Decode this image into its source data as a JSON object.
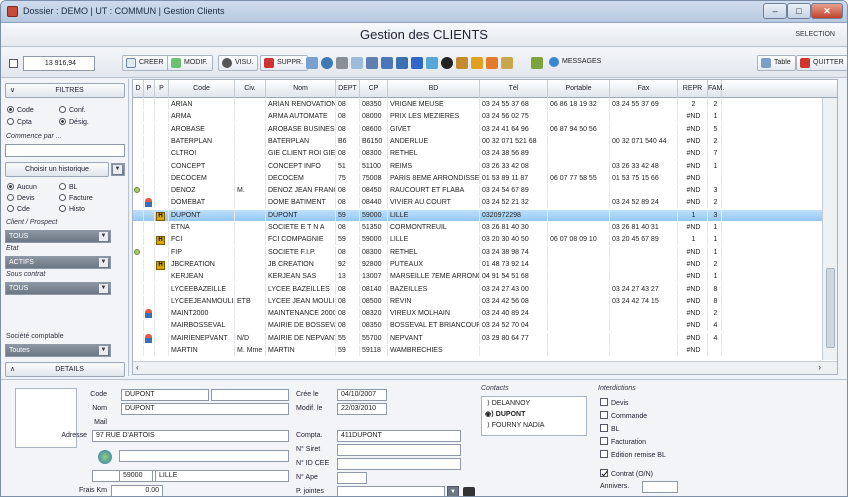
{
  "window": {
    "title": "Dossier : DEMO | UT : COMMUN | Gestion Clients"
  },
  "header": {
    "title": "Gestion des CLIENTS",
    "selection": "SELECTION"
  },
  "toolbar": {
    "count": "13 916,94",
    "creer": "CREER",
    "modif": "MODIF.",
    "visu": "VISU.",
    "suppr": "SUPPR.",
    "messages": "MESSAGES",
    "table": "Table",
    "quitter": "QUITTER"
  },
  "left": {
    "filters": "FILTRES",
    "radio1": [
      "Code",
      "Conf.",
      "Cpta",
      "Désig."
    ],
    "commence_label": "Commence par ...",
    "historique": "Choisir un historique",
    "radio2": [
      "Aucun",
      "BL",
      "Devis",
      "Facture",
      "Cde",
      "Histo"
    ],
    "client_label": "Client / Prospect",
    "client_value": "TOUS",
    "etat_label": "Etat",
    "etat_value": "ACTIFS",
    "contrat_label": "Sous contrat",
    "contrat_value": "TOUS",
    "societe_label": "Société comptable",
    "societe_value": "Toutes",
    "details": "DETAILS"
  },
  "grid": {
    "headers": [
      "D",
      "P",
      "P",
      "Code",
      "Civ.",
      "Nom",
      "DEPT",
      "CP",
      "BD",
      "Tél",
      "Portable",
      "Fax",
      "REPR",
      "FAM."
    ],
    "rows": [
      [
        "",
        "",
        "",
        "ARIAN",
        "",
        "ARIAN RENOVATION",
        "08",
        "08350",
        "VRIGNE MEUSE",
        "03 24 55 37 68",
        "06 86 18 19 32",
        "03 24 55 37 69",
        "2",
        "2"
      ],
      [
        "",
        "",
        "",
        "ARMA",
        "",
        "ARMA AUTOMATE",
        "08",
        "08000",
        "PRIX LES MEZIERES",
        "03 24 56 02 75",
        "",
        "",
        "#ND",
        "1"
      ],
      [
        "",
        "",
        "",
        "AROBASE",
        "",
        "AROBASE BUSINESS",
        "08",
        "08600",
        "GIVET",
        "03 24 41 64 96",
        "06 87 94 50 56",
        "",
        "#ND",
        "5"
      ],
      [
        "",
        "",
        "",
        "BATERPLAN",
        "",
        "BATERPLAN",
        "B6",
        "B6150",
        "ANDERLUE",
        "00 32 071 521 68",
        "",
        "00 32 071 540 44",
        "#ND",
        "2"
      ],
      [
        "",
        "",
        "",
        "CLTROI",
        "",
        "GIE CLIENT ROI GIE",
        "08",
        "08300",
        "RETHEL",
        "03 24 38 56 89",
        "",
        "",
        "#ND",
        "7"
      ],
      [
        "",
        "",
        "",
        "CONCEPT",
        "",
        "CONCEPT INFO",
        "51",
        "51100",
        "REIMS",
        "03 26 33 42 08",
        "",
        "03 26 33 42 48",
        "#ND",
        "1"
      ],
      [
        "",
        "",
        "",
        "DECOCEM",
        "",
        "DECOCEM",
        "75",
        "75008",
        "PARIS 8EME ARRONDISSE",
        "01 53 89 11 87",
        "06 07 77 58 55",
        "01 53 75 15 66",
        "#ND",
        ""
      ],
      [
        "dot",
        "",
        "",
        "DENOZ",
        "M.",
        "DENOZ JEAN FRANCO",
        "08",
        "08450",
        "RAUCOURT ET FLABA",
        "03 24 54 67 89",
        "",
        "",
        "#ND",
        "3"
      ],
      [
        "",
        "pers",
        "",
        "DOMEBAT",
        "",
        "DOME BATIMENT",
        "08",
        "08440",
        "VIVIER AU COURT",
        "03 24 52 21 32",
        "",
        "03 24 52 89 24",
        "#ND",
        "2"
      ],
      [
        "",
        "",
        "H",
        "DUPONT",
        "",
        "DUPONT",
        "59",
        "59000",
        "LILLE",
        "0320972298",
        "",
        "",
        "1",
        "3"
      ],
      [
        "",
        "",
        "",
        "ETNA",
        "",
        "SOCIETE E T N A",
        "08",
        "51350",
        "CORMONTREUIL",
        "03 26 81 40 30",
        "",
        "03 26 81 40 31",
        "#ND",
        "1"
      ],
      [
        "",
        "",
        "H",
        "FCI",
        "",
        "FCI COMPAGNIE",
        "59",
        "59000",
        "LILLE",
        "03 20 30 40 50",
        "06 07 08 09 10",
        "03 20 45 67 89",
        "1",
        "1"
      ],
      [
        "dot",
        "",
        "",
        "FIP",
        "",
        "SOCIETE F.I.P.",
        "08",
        "08300",
        "RETHEL",
        "03 24 38 98 74",
        "",
        "",
        "#ND",
        "1"
      ],
      [
        "",
        "",
        "H",
        "JBCREATION",
        "",
        "JB CREATION",
        "92",
        "92800",
        "PUTEAUX",
        "01 48 73 92 14",
        "",
        "",
        "#ND",
        "2"
      ],
      [
        "",
        "",
        "",
        "KERJEAN",
        "",
        "KERJEAN SAS",
        "13",
        "13007",
        "MARSEILLE 7EME ARRONC",
        "04 91 54 51 68",
        "",
        "",
        "#ND",
        "1"
      ],
      [
        "",
        "",
        "",
        "LYCEEBAZEILLE",
        "",
        "LYCEE BAZEILLES",
        "08",
        "08140",
        "BAZEILLES",
        "03 24 27 43 00",
        "",
        "03 24 27 43 27",
        "#ND",
        "8"
      ],
      [
        "",
        "",
        "",
        "LYCEEJEANMOULI",
        "ETB",
        "LYCEE JEAN MOULIN",
        "08",
        "08500",
        "REVIN",
        "03 24 42 56 08",
        "",
        "03 24 42 74 15",
        "#ND",
        "8"
      ],
      [
        "",
        "pers",
        "",
        "MAINT2000",
        "",
        "MAINTENANCE 2000",
        "08",
        "08320",
        "VIREUX MOLHAIN",
        "03 24 40 89 24",
        "",
        "",
        "#ND",
        "2"
      ],
      [
        "",
        "",
        "",
        "MAIRBOSSEVAL",
        "",
        "MAIRIE DE BOSSEVAL",
        "08",
        "08350",
        "BOSSEVAL ET BRIANCOUR",
        "03 24 52 70 04",
        "",
        "",
        "#ND",
        "4"
      ],
      [
        "",
        "pers",
        "",
        "MAIRIENEPVANT",
        "N/D",
        "MAIRIE DE NEPVANT",
        "55",
        "55700",
        "NEPVANT",
        "03 29 80 64 77",
        "",
        "",
        "#ND",
        "4"
      ],
      [
        "",
        "",
        "",
        "MARTIN",
        "M. Mme",
        "MARTIN",
        "59",
        "59118",
        "WAMBRECHIES",
        "",
        "",
        "",
        "#ND",
        ""
      ]
    ],
    "selected_index": 9
  },
  "detail": {
    "code_label": "Code",
    "code": "DUPONT",
    "nom_label": "Nom",
    "nom": "DUPONT",
    "mail_label": "Mail",
    "adresse_label": "Adresse",
    "adresse": "97 RUE D'ARTOIS",
    "cp": "59000",
    "ville": "LILLE",
    "frais_label": "Frais Km",
    "frais": "0.00",
    "cree_label": "Crée le",
    "cree": "04/10/2007",
    "modif_label": "Modif. le",
    "modif": "22/03/2010",
    "compta_label": "Compta.",
    "compta": "411DUPONT",
    "siret_label": "N° Siret",
    "idcee_label": "N° ID CEE",
    "ape_label": "N° Ape",
    "pj_label": "P. jointes",
    "contacts_label": "Contacts",
    "contacts": [
      "DELANNOY",
      "DUPONT",
      "FOURNY NADIA"
    ],
    "interdictions_label": "Interdictions",
    "interdictions": [
      "Devis",
      "Commande",
      "BL",
      "Facturation",
      "Edition remise BL"
    ],
    "contrat": "Contrat (O/N)",
    "annivers": "Annivers."
  }
}
